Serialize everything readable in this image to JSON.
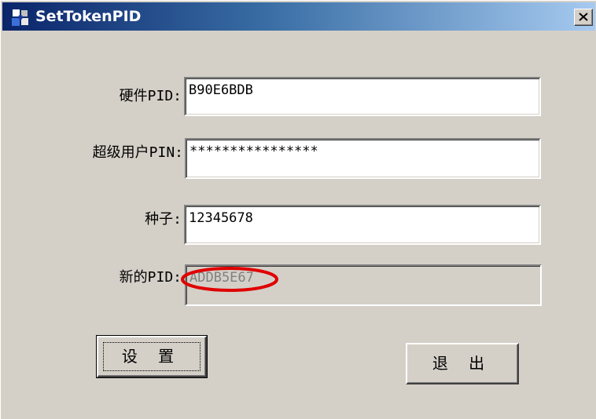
{
  "window": {
    "title": "SetTokenPID"
  },
  "form": {
    "hardware_pid": {
      "label": "硬件PID:",
      "value": "B90E6BDB"
    },
    "super_user_pin": {
      "label": "超级用户PIN:",
      "value": "****************"
    },
    "seed": {
      "label": "种子:",
      "value": "12345678"
    },
    "new_pid": {
      "label": "新的PID:",
      "value": "ADDB5E67"
    }
  },
  "buttons": {
    "set": "设 置",
    "exit": "退 出"
  },
  "icons": {
    "app": "app-icon",
    "close": "close-icon"
  },
  "colors": {
    "titlebar_start": "#0a246a",
    "titlebar_end": "#a6caf0",
    "dialog_bg": "#d4d0c8",
    "highlight": "#e00000"
  }
}
